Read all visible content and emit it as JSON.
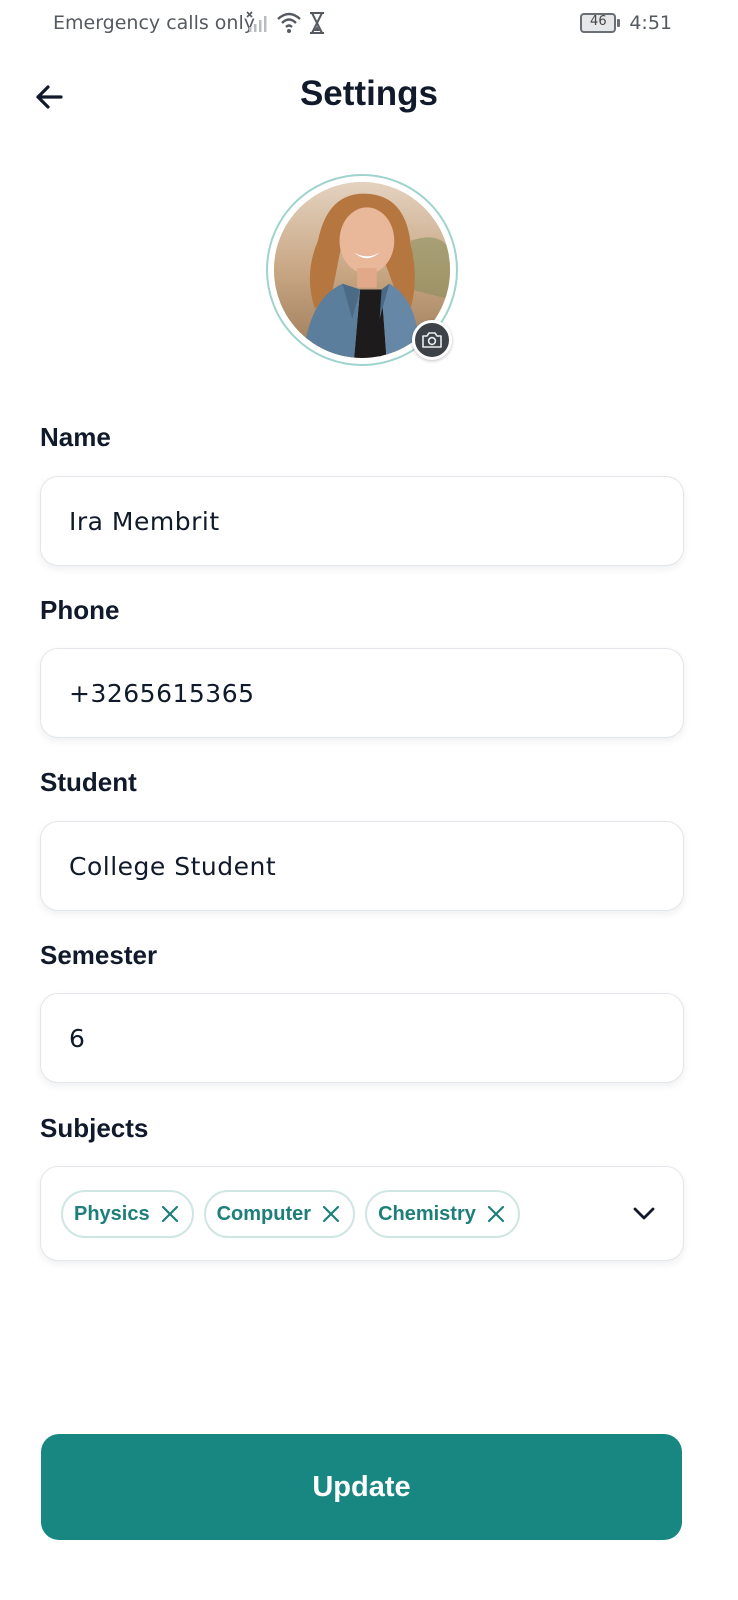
{
  "status_bar": {
    "carrier_text": "Emergency calls only",
    "battery_level": "46",
    "time": "4:51",
    "icons": [
      "no-signal-icon",
      "wifi-icon",
      "hourglass-icon",
      "battery-icon"
    ]
  },
  "header": {
    "title": "Settings",
    "back_icon": "arrow-left-icon"
  },
  "profile": {
    "camera_icon": "camera-icon"
  },
  "form": {
    "name_label": "Name",
    "name_value": "Ira Membrit",
    "phone_label": "Phone",
    "phone_value": "+3265615365",
    "student_label": "Student",
    "student_value": "College Student",
    "semester_label": "Semester",
    "semester_value": "6",
    "subjects_label": "Subjects",
    "subjects": [
      {
        "label": "Physics"
      },
      {
        "label": "Computer"
      },
      {
        "label": "Chemistry"
      }
    ],
    "subjects_dropdown_icon": "chevron-down-icon"
  },
  "actions": {
    "update_label": "Update"
  },
  "colors": {
    "accent": "#188782",
    "chip_text": "#1e7f7a",
    "chip_border": "#cfe6e3",
    "title": "#111a2b"
  }
}
